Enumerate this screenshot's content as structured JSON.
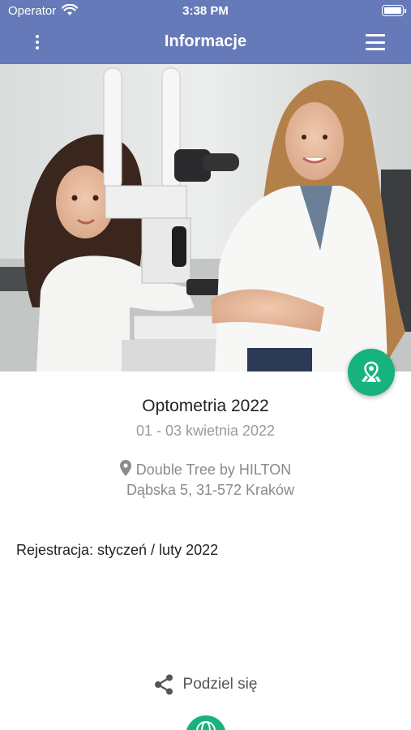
{
  "status_bar": {
    "carrier": "Operator",
    "time": "3:38 PM"
  },
  "nav": {
    "title": "Informacje",
    "left_icon": "more-vertical-icon",
    "right_icon": "hamburger-menu-icon"
  },
  "hero": {
    "image": "photo-optometrist-with-child"
  },
  "event": {
    "title": "Optometria 2022",
    "dates": "01 - 03 kwietnia 2022",
    "venue_name": "Double Tree by HILTON",
    "venue_address": "Dąbska 5, 31-572 Kraków"
  },
  "registration": {
    "text": "Rejestracja: styczeń / luty 2022"
  },
  "actions": {
    "share_label": "Podziel się",
    "map_icon": "map-pin-icon",
    "globe_icon": "globe-icon"
  },
  "colors": {
    "header": "#6679b8",
    "accent": "#16b37e"
  }
}
